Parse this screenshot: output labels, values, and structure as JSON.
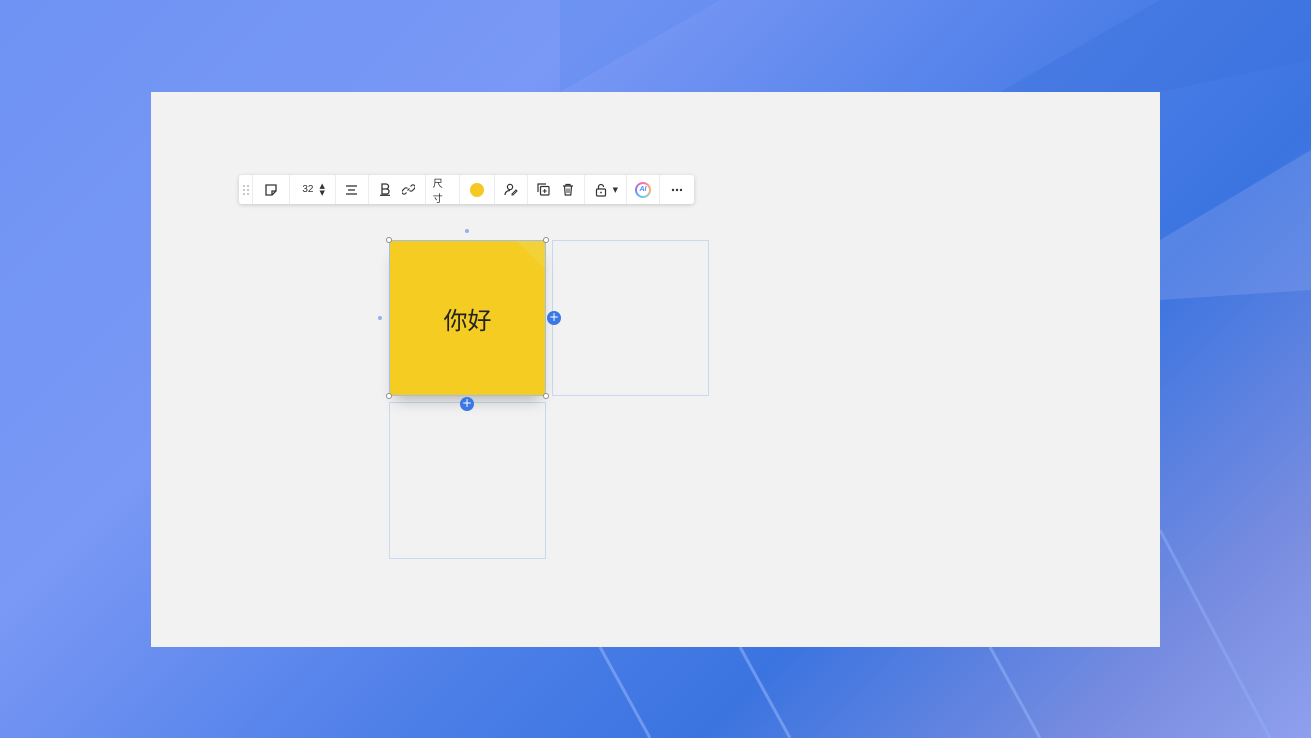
{
  "toolbar": {
    "font_size": "32",
    "size_label": "尺寸",
    "ai_label": "AI",
    "note_color": "#f5c823"
  },
  "note": {
    "text": "你好",
    "color": "#f5cd22"
  },
  "colors": {
    "accent": "#3a78e4",
    "canvas": "#f2f2f2"
  },
  "icons": [
    "drag-grip-icon",
    "sticky-note-icon",
    "stepper-up-icon",
    "stepper-down-icon",
    "align-center-icon",
    "bold-icon",
    "link-icon",
    "user-edit-icon",
    "duplicate-icon",
    "trash-icon",
    "lock-icon",
    "chevron-down-icon",
    "ai-icon",
    "more-icon",
    "plus-icon"
  ]
}
